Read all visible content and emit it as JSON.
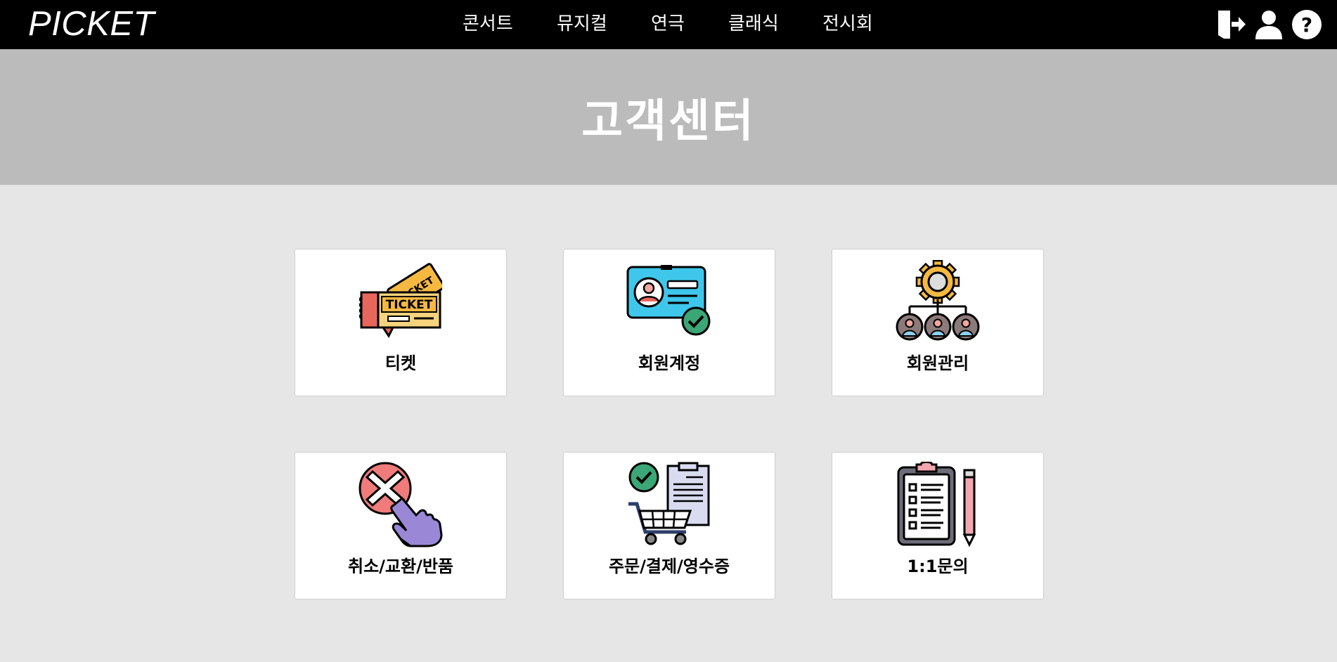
{
  "header": {
    "logo": "PICKET",
    "menu": [
      {
        "label": "콘서트"
      },
      {
        "label": "뮤지컬"
      },
      {
        "label": "연극"
      },
      {
        "label": "클래식"
      },
      {
        "label": "전시회"
      }
    ],
    "icons": [
      "logout-icon",
      "user-icon",
      "help-icon"
    ]
  },
  "banner": {
    "title": "고객센터"
  },
  "cards": [
    {
      "label": "티켓",
      "icon": "ticket-icon"
    },
    {
      "label": "회원계정",
      "icon": "id-card-icon"
    },
    {
      "label": "회원관리",
      "icon": "member-management-icon"
    },
    {
      "label": "취소/교환/반품",
      "icon": "cancel-hand-icon"
    },
    {
      "label": "주문/결제/영수증",
      "icon": "cart-receipt-icon"
    },
    {
      "label": "1:1문의",
      "icon": "clipboard-pencil-icon"
    }
  ],
  "colors": {
    "nav_bg": "#000000",
    "banner_bg": "#bbbbbb",
    "page_bg": "#e6e6e6",
    "card_bg": "#ffffff"
  }
}
